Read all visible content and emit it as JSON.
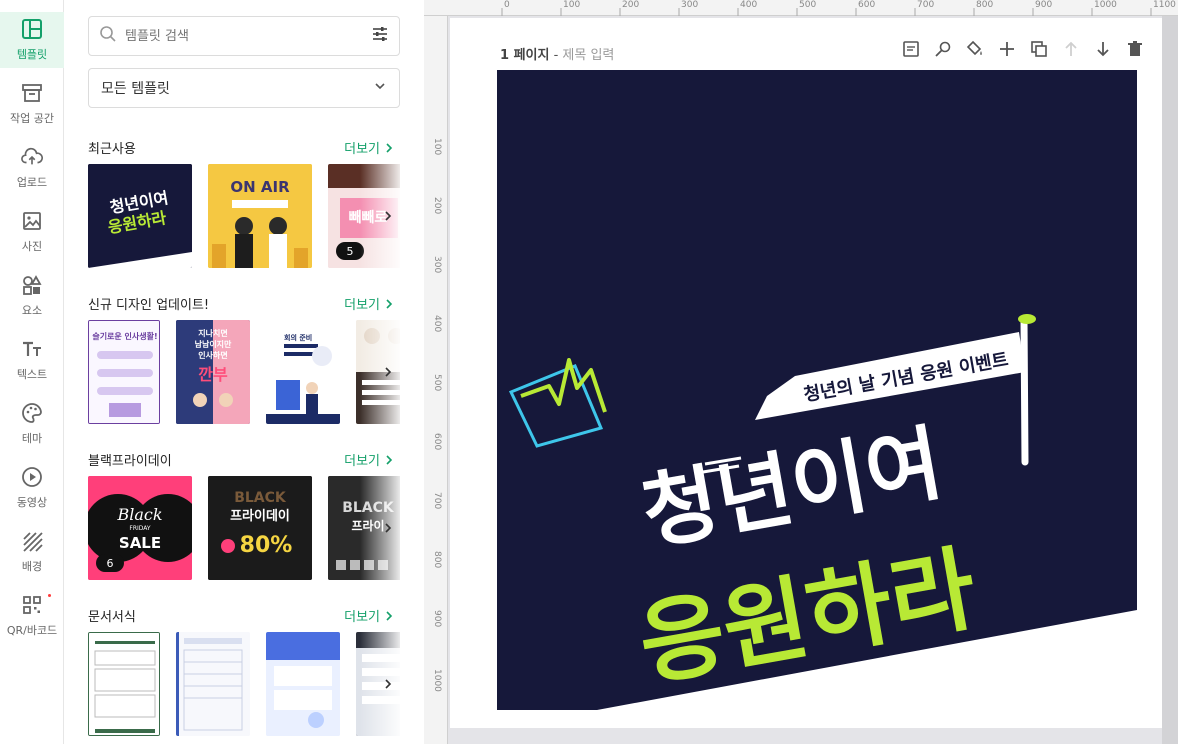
{
  "rail": {
    "items": [
      {
        "label": "템플릿",
        "icon": "template-icon",
        "active": true
      },
      {
        "label": "작업 공간",
        "icon": "archive-icon"
      },
      {
        "label": "업로드",
        "icon": "cloud-upload-icon"
      },
      {
        "label": "사진",
        "icon": "image-icon"
      },
      {
        "label": "요소",
        "icon": "shapes-icon"
      },
      {
        "label": "텍스트",
        "icon": "text-icon"
      },
      {
        "label": "테마",
        "icon": "palette-icon"
      },
      {
        "label": "동영상",
        "icon": "play-icon"
      },
      {
        "label": "배경",
        "icon": "pattern-icon"
      },
      {
        "label": "QR/바코드",
        "icon": "qr-icon"
      }
    ]
  },
  "panel": {
    "search_placeholder": "템플릿 검색",
    "filter_select": "모든 템플릿",
    "more_label": "더보기",
    "sections": [
      {
        "title": "최근사용",
        "badges": {
          "third": "5"
        }
      },
      {
        "title": "신규 디자인 업데이트!"
      },
      {
        "title": "블랙프라이데이",
        "badges": {
          "first": "6"
        }
      },
      {
        "title": "문서서식"
      }
    ],
    "thumbs": {
      "recent_1": {
        "line1": "청년이여",
        "line2": "응원하라"
      },
      "recent_2": {
        "title": "ON AIR"
      },
      "recent_3": {
        "text": "빼빼로"
      },
      "new_1": {
        "text": "슬기로운 인사생활!"
      },
      "new_2": {
        "line1": "지나치면",
        "line2": "남남이지만",
        "line3": "인사하면",
        "line4": "깐부"
      },
      "new_3": {
        "text": "회의 준비"
      },
      "black_1": {
        "script": "Black",
        "sub": "FRIDAY",
        "sale": "SALE"
      },
      "black_2": {
        "line1": "BLACK",
        "line2": "프라이데이",
        "pct": "80%"
      },
      "black_3": {
        "line1": "BLACK",
        "line2": "프라이"
      }
    }
  },
  "workspace": {
    "ruler_top": [
      "0",
      "100",
      "200",
      "300",
      "400",
      "500",
      "600",
      "700",
      "800",
      "900",
      "1000",
      "1100"
    ],
    "ruler_left": [
      "100",
      "200",
      "300",
      "400",
      "500",
      "600",
      "700",
      "800",
      "900",
      "1000"
    ],
    "page_label": "1 페이지",
    "page_title_placeholder": "제목 입력",
    "tools": [
      "note-icon",
      "magic-icon",
      "fill-icon",
      "add-page-icon",
      "duplicate-icon",
      "move-up-icon",
      "move-down-icon",
      "delete-icon"
    ]
  },
  "design": {
    "banner": "청년의 날 기념 응원 이벤트",
    "line1": "청년이여",
    "line2": "응원하라",
    "colors": {
      "bg": "#16183a",
      "accent": "#b8e935",
      "cyan": "#3ec6ea"
    }
  }
}
